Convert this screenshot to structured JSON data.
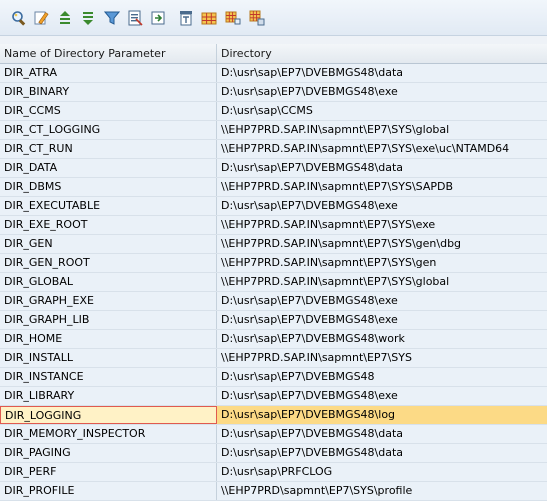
{
  "toolbar": {
    "buttons": [
      {
        "name": "details-button",
        "icon": "magnifier-icon"
      },
      {
        "name": "edit-button",
        "icon": "pencil-icon"
      },
      {
        "name": "sort-ascending-button",
        "icon": "sort-ascending-icon"
      },
      {
        "name": "sort-descending-button",
        "icon": "sort-descending-icon"
      },
      {
        "name": "filter-button",
        "icon": "filter-icon"
      },
      {
        "name": "spreadsheet-button",
        "icon": "excel-icon"
      },
      {
        "name": "export-button",
        "icon": "export-icon"
      },
      {
        "name": "print-preview-button",
        "icon": "print-preview-icon"
      },
      {
        "name": "layout-button",
        "icon": "grid-layout-icon"
      },
      {
        "name": "select-all-button",
        "icon": "select-grid-icon"
      },
      {
        "name": "deselect-button",
        "icon": "deselect-grid-icon"
      }
    ]
  },
  "table": {
    "columns": [
      "Name of Directory Parameter",
      "Directory"
    ],
    "selected_index": 18,
    "rows": [
      [
        "DIR_ATRA",
        "D:\\usr\\sap\\EP7\\DVEBMGS48\\data"
      ],
      [
        "DIR_BINARY",
        "D:\\usr\\sap\\EP7\\DVEBMGS48\\exe"
      ],
      [
        "DIR_CCMS",
        "D:\\usr\\sap\\CCMS"
      ],
      [
        "DIR_CT_LOGGING",
        "\\\\EHP7PRD.SAP.IN\\sapmnt\\EP7\\SYS\\global"
      ],
      [
        "DIR_CT_RUN",
        "\\\\EHP7PRD.SAP.IN\\sapmnt\\EP7\\SYS\\exe\\uc\\NTAMD64"
      ],
      [
        "DIR_DATA",
        "D:\\usr\\sap\\EP7\\DVEBMGS48\\data"
      ],
      [
        "DIR_DBMS",
        "\\\\EHP7PRD.SAP.IN\\sapmnt\\EP7\\SYS\\SAPDB"
      ],
      [
        "DIR_EXECUTABLE",
        "D:\\usr\\sap\\EP7\\DVEBMGS48\\exe"
      ],
      [
        "DIR_EXE_ROOT",
        "\\\\EHP7PRD.SAP.IN\\sapmnt\\EP7\\SYS\\exe"
      ],
      [
        "DIR_GEN",
        "\\\\EHP7PRD.SAP.IN\\sapmnt\\EP7\\SYS\\gen\\dbg"
      ],
      [
        "DIR_GEN_ROOT",
        "\\\\EHP7PRD.SAP.IN\\sapmnt\\EP7\\SYS\\gen"
      ],
      [
        "DIR_GLOBAL",
        "\\\\EHP7PRD.SAP.IN\\sapmnt\\EP7\\SYS\\global"
      ],
      [
        "DIR_GRAPH_EXE",
        "D:\\usr\\sap\\EP7\\DVEBMGS48\\exe"
      ],
      [
        "DIR_GRAPH_LIB",
        "D:\\usr\\sap\\EP7\\DVEBMGS48\\exe"
      ],
      [
        "DIR_HOME",
        "D:\\usr\\sap\\EP7\\DVEBMGS48\\work"
      ],
      [
        "DIR_INSTALL",
        "\\\\EHP7PRD.SAP.IN\\sapmnt\\EP7\\SYS"
      ],
      [
        "DIR_INSTANCE",
        "D:\\usr\\sap\\EP7\\DVEBMGS48"
      ],
      [
        "DIR_LIBRARY",
        "D:\\usr\\sap\\EP7\\DVEBMGS48\\exe"
      ],
      [
        "DIR_LOGGING",
        "D:\\usr\\sap\\EP7\\DVEBMGS48\\log"
      ],
      [
        "DIR_MEMORY_INSPECTOR",
        "D:\\usr\\sap\\EP7\\DVEBMGS48\\data"
      ],
      [
        "DIR_PAGING",
        "D:\\usr\\sap\\EP7\\DVEBMGS48\\data"
      ],
      [
        "DIR_PERF",
        "D:\\usr\\sap\\PRFCLOG"
      ],
      [
        "DIR_PROFILE",
        "\\\\EHP7PRD\\sapmnt\\EP7\\SYS\\profile"
      ]
    ]
  }
}
